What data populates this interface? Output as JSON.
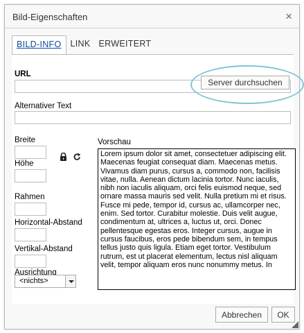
{
  "dialog": {
    "title": "Bild-Eigenschaften",
    "close_glyph": "×"
  },
  "tabs": [
    {
      "label": "BILD-INFO",
      "active": true
    },
    {
      "label": "LINK",
      "active": false
    },
    {
      "label": "ERWEITERT",
      "active": false
    }
  ],
  "form": {
    "url_label": "URL",
    "url_value": "",
    "browse_button": "Server durchsuchen",
    "alt_label": "Alternativer Text",
    "alt_value": "",
    "width_label": "Breite",
    "height_label": "Höhe",
    "border_label": "Rahmen",
    "hspace_label": "Horizontal-Abstand",
    "vspace_label": "Vertikal-Abstand",
    "align_label": "Ausrichtung",
    "align_value": "<nichts>",
    "preview_label": "Vorschau",
    "preview_text": "Lorem ipsum dolor sit amet, consectetuer adipiscing elit. Maecenas feugiat consequat diam. Maecenas metus. Vivamus diam purus, cursus a, commodo non, facilisis vitae, nulla. Aenean dictum lacinia tortor. Nunc iaculis, nibh non iaculis aliquam, orci felis euismod neque, sed ornare massa mauris sed velit. Nulla pretium mi et risus. Fusce mi pede, tempor id, cursus ac, ullamcorper nec, enim. Sed tortor. Curabitur molestie. Duis velit augue, condimentum at, ultrices a, luctus ut, orci. Donec pellentesque egestas eros. Integer cursus, augue in cursus faucibus, eros pede bibendum sem, in tempus tellus justo quis ligula. Etiam eget tortor. Vestibulum rutrum, est ut placerat elementum, lectus nisl aliquam velit, tempor aliquam eros nunc nonummy metus. In"
  },
  "footer": {
    "cancel_button": "Abbrechen",
    "ok_button": "OK"
  },
  "icons": {
    "lock": "lock-icon",
    "reset": "reset-size-icon"
  },
  "colors": {
    "highlight_oval": "#7cc6d6",
    "active_tab_text": "#0e4ca0"
  }
}
